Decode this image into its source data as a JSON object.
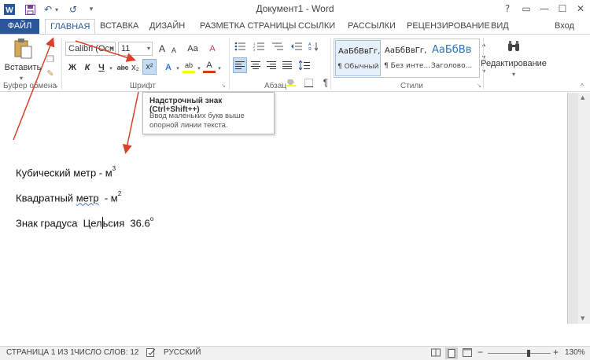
{
  "window": {
    "title": "Документ1 - Word",
    "help": "?",
    "ribbon_opts": "▭",
    "minimize": "—",
    "maximize": "☐",
    "close": "✕",
    "user": "Вход"
  },
  "quick_access": {
    "undo": "↶",
    "redo": "↺",
    "more": "▾"
  },
  "tabs": {
    "file": "ФАЙЛ",
    "items": [
      "ГЛАВНАЯ",
      "ВСТАВКА",
      "ДИЗАЙН",
      "РАЗМЕТКА СТРАНИЦЫ",
      "ССЫЛКИ",
      "РАССЫЛКИ",
      "РЕЦЕНЗИРОВАНИЕ",
      "ВИД"
    ]
  },
  "ribbon": {
    "clipboard": {
      "paste_label": "Вставить",
      "group": "Буфер обмена"
    },
    "font": {
      "group": "Шрифт",
      "font_name": "Calibri (Осн",
      "font_size": "11",
      "bold": "Ж",
      "italic": "К",
      "underline": "Ч",
      "strikethrough": "abc",
      "subscript": "x₂",
      "superscript": "x²",
      "grow": "A",
      "shrink": "A",
      "case": "Aa",
      "clear": "A",
      "text_effects": "A",
      "highlight": "ab",
      "font_color": "A"
    },
    "paragraph": {
      "group": "Абзац",
      "pilcrow": "¶"
    },
    "styles": {
      "group": "Стили",
      "items": [
        {
          "preview": "АаБбВвГг,",
          "name": "¶ Обычный"
        },
        {
          "preview": "АаБбВвГг,",
          "name": "¶ Без инте..."
        },
        {
          "preview": "АаБбВв",
          "name": "Заголово..."
        }
      ]
    },
    "editing": {
      "label": "Редактирование"
    }
  },
  "tooltip": {
    "title": "Надстрочный знак (Ctrl+Shift++)",
    "body": "Ввод маленьких букв выше опорной линии текста."
  },
  "document": {
    "line1": "Кубический метр - м",
    "line1_sup": "3",
    "line2_pre": "Квадратный ",
    "line2_word": "метр",
    "line2_post": "  - м",
    "line2_sup": "2",
    "line3_a": "Знак градуса  Цел",
    "line3_b": "ьсия  36.6",
    "line3_sup": "o"
  },
  "statusbar": {
    "page": "СТРАНИЦА 1 ИЗ 1",
    "words": "ЧИСЛО СЛОВ: 12",
    "language": "РУССКИЙ",
    "zoom": "130%",
    "zoom_level": 0.65
  },
  "colors": {
    "accent": "#2b579a",
    "arrow": "#d9412b",
    "highlight": "#ffff00",
    "font_color": "#e03a1e"
  }
}
